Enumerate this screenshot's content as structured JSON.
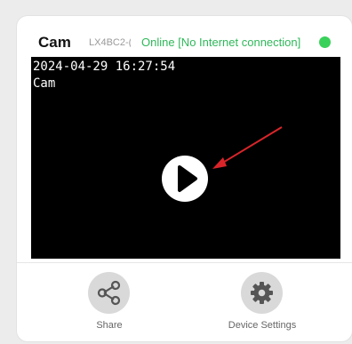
{
  "device": {
    "name": "Cam",
    "id": "LX4BC2-(",
    "status": "Online [No Internet connection]",
    "status_color": "#2fb85a",
    "indicator_color": "#3ad15a"
  },
  "video": {
    "timestamp": "2024-04-29 16:27:54",
    "overlay_name": "Cam",
    "play_icon": "play-icon",
    "annotation_color": "#d9252a"
  },
  "actions": [
    {
      "label": "Share",
      "icon": "share-icon"
    },
    {
      "label": "Device Settings",
      "icon": "gear-icon"
    }
  ]
}
